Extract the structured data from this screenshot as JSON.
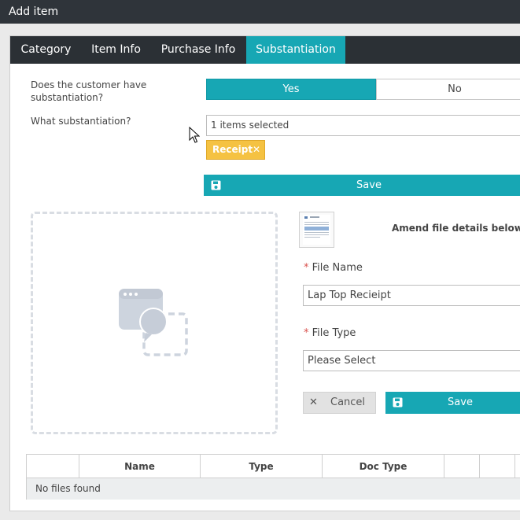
{
  "window": {
    "title": "Add item"
  },
  "tabs": [
    {
      "label": "Category"
    },
    {
      "label": "Item Info"
    },
    {
      "label": "Purchase Info"
    },
    {
      "label": "Substantiation"
    }
  ],
  "form": {
    "question_substantiation": "Does the customer have substantiation?",
    "yes_label": "Yes",
    "no_label": "No",
    "question_what": "What substantiation?",
    "selected_summary": "1 items selected",
    "chip_label": "Receipt",
    "save_label": "Save"
  },
  "file_details": {
    "heading": "Amend file details below.",
    "file_name_label": "File Name",
    "file_name_value": "Lap Top Recieipt",
    "file_type_label": "File Type",
    "file_type_value": "Please Select",
    "cancel_label": "Cancel",
    "save_label": "Save",
    "required_marker": "*"
  },
  "files_table": {
    "columns": [
      "",
      "Name",
      "Type",
      "Doc Type",
      "",
      "",
      ""
    ],
    "empty_message": "No files found"
  },
  "colors": {
    "accent": "#17a7b4",
    "chip": "#f5c242",
    "titlebar": "#2f343a",
    "tabbar": "#2b3035"
  }
}
